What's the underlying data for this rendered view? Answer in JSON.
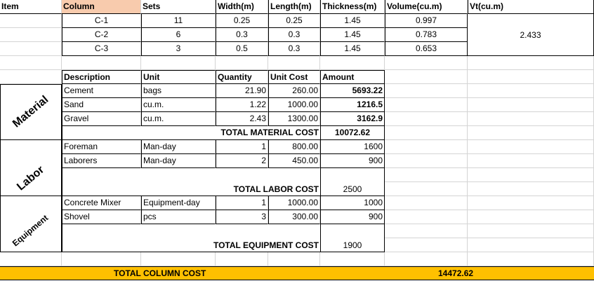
{
  "header": {
    "item": "Item",
    "column": "Column",
    "sets": "Sets",
    "width": "Width(m)",
    "length": "Length(m)",
    "thickness": "Thickness(m)",
    "volume": "Volume(cu.m)",
    "vt": "Vt(cu.m)"
  },
  "columns": [
    {
      "column": "C-1",
      "sets": "11",
      "width": "0.25",
      "length": "0.25",
      "thickness": "1.45",
      "volume": "0.997"
    },
    {
      "column": "C-2",
      "sets": "6",
      "width": "0.3",
      "length": "0.3",
      "thickness": "1.45",
      "volume": "0.783"
    },
    {
      "column": "C-3",
      "sets": "3",
      "width": "0.5",
      "length": "0.3",
      "thickness": "1.45",
      "volume": "0.653"
    }
  ],
  "vt_total": "2.433",
  "cost_header": {
    "description": "Description",
    "unit": "Unit",
    "quantity": "Quantity",
    "unit_cost": "Unit Cost",
    "amount": "Amount"
  },
  "groups": {
    "material": "Material",
    "labor": "Labor",
    "equipment": "Equipment"
  },
  "material": [
    {
      "description": "Cement",
      "unit": "bags",
      "quantity": "21.90",
      "unit_cost": "260.00",
      "amount": "5693.22"
    },
    {
      "description": "Sand",
      "unit": "cu.m.",
      "quantity": "1.22",
      "unit_cost": "1000.00",
      "amount": "1216.5"
    },
    {
      "description": "Gravel",
      "unit": "cu.m.",
      "quantity": "2.43",
      "unit_cost": "1300.00",
      "amount": "3162.9"
    }
  ],
  "material_total": {
    "label": "TOTAL MATERIAL COST",
    "value": "10072.62"
  },
  "labor": [
    {
      "description": "Foreman",
      "unit": "Man-day",
      "quantity": "1",
      "unit_cost": "800.00",
      "amount": "1600"
    },
    {
      "description": "Laborers",
      "unit": "Man-day",
      "quantity": "2",
      "unit_cost": "450.00",
      "amount": "900"
    }
  ],
  "labor_total": {
    "label": "TOTAL LABOR COST",
    "value": "2500"
  },
  "equipment": [
    {
      "description": "Concrete Mixer",
      "unit": "Equipment-day",
      "quantity": "1",
      "unit_cost": "1000.00",
      "amount": "1000"
    },
    {
      "description": "Shovel",
      "unit": "pcs",
      "quantity": "3",
      "unit_cost": "300.00",
      "amount": "900"
    }
  ],
  "equipment_total": {
    "label": "TOTAL EQUIPMENT COST",
    "value": "1900"
  },
  "grand_total": {
    "label": "TOTAL COLUMN COST",
    "value": "14472.62"
  },
  "colors": {
    "header_fill": "#f8cbad",
    "total_fill": "#ffc000",
    "gridline": "#d4d4d4"
  }
}
